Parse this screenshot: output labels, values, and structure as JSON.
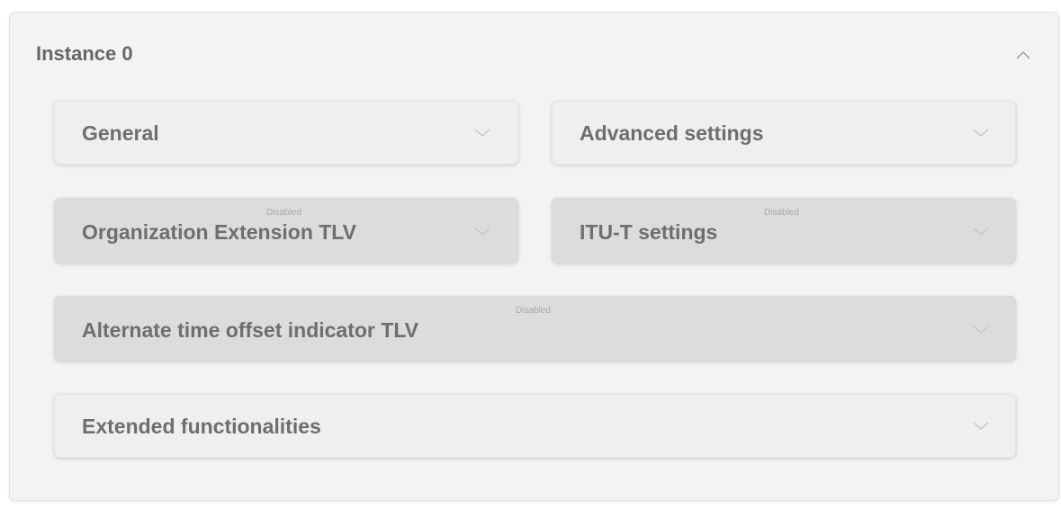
{
  "instance": {
    "title": "Instance 0",
    "collapse_icon": "chevron-up-icon"
  },
  "sections": {
    "general": {
      "label": "General",
      "state": "enabled"
    },
    "advanced": {
      "label": "Advanced settings",
      "state": "enabled"
    },
    "org_ext": {
      "label": "Organization Extension TLV",
      "status": "Disabled",
      "state": "disabled"
    },
    "itu_t": {
      "label": "ITU-T settings",
      "status": "Disabled",
      "state": "disabled"
    },
    "alt_time": {
      "label": "Alternate time offset indicator TLV",
      "status": "Disabled",
      "state": "disabled"
    },
    "extended": {
      "label": "Extended functionalities",
      "state": "enabled"
    }
  },
  "colors": {
    "panel_bg": "#f3f3f3",
    "card_enabled_bg": "#efefef",
    "card_disabled_bg": "#dcdcdc",
    "text": "#6e6e6e",
    "status_text": "#a7a7a7",
    "chevron": "#c4c4c4"
  }
}
